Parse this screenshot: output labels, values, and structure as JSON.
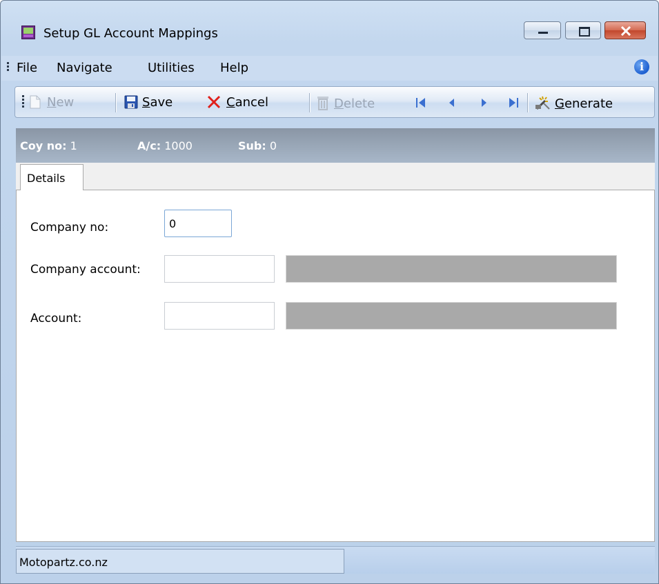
{
  "window": {
    "title": "Setup GL Account Mappings",
    "colors": {
      "frame": "#c3d7ee",
      "close_button": "#c2472d",
      "header_strip": "#8a96a5"
    }
  },
  "menu": {
    "items": [
      "File",
      "Navigate",
      "Utilities",
      "Help"
    ],
    "info_icon": "info-icon"
  },
  "toolbar": {
    "new": {
      "pre": "",
      "acc": "N",
      "post": "ew",
      "enabled": false,
      "icon": "new-document-icon"
    },
    "save": {
      "pre": "",
      "acc": "S",
      "post": "ave",
      "enabled": true,
      "icon": "floppy-disk-icon"
    },
    "cancel": {
      "pre": "",
      "acc": "C",
      "post": "ancel",
      "enabled": true,
      "icon": "red-x-icon"
    },
    "delete": {
      "pre": "",
      "acc": "D",
      "post": "elete",
      "enabled": false,
      "icon": "trash-icon"
    },
    "nav": [
      "first-record-icon",
      "previous-record-icon",
      "next-record-icon",
      "last-record-icon"
    ],
    "generate": {
      "pre": "",
      "acc": "G",
      "post": "enerate",
      "enabled": true,
      "icon": "wand-icon"
    }
  },
  "header": {
    "coy_label": "Coy no:",
    "coy_value": "1",
    "ac_label": "A/c:",
    "ac_value": "1000",
    "sub_label": "Sub:",
    "sub_value": "0"
  },
  "tabs": [
    {
      "label": "Details",
      "selected": true
    }
  ],
  "form": {
    "company_no_label": "Company no:",
    "company_no_value": "0",
    "company_account_label": "Company account:",
    "company_account_value": "",
    "company_account_desc": "",
    "account_label": "Account:",
    "account_value": "",
    "account_desc": ""
  },
  "status": {
    "text": "Motopartz.co.nz"
  }
}
